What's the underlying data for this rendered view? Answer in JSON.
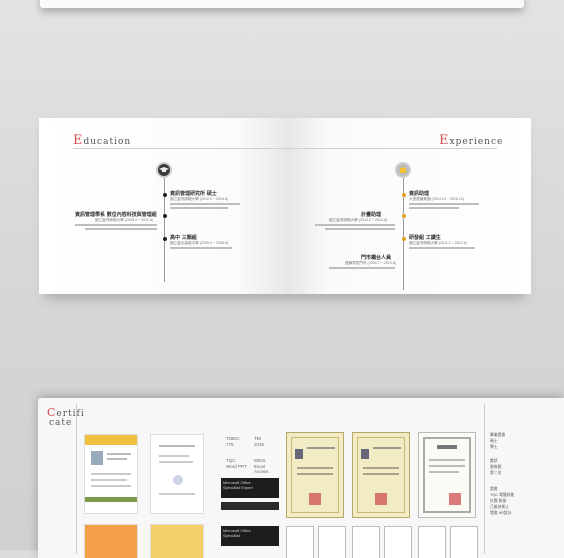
{
  "education": {
    "heading_cap": "E",
    "heading_rest": "ducation",
    "entries": [
      {
        "title": "資訊管理研究所 碩士",
        "sub": "國立臺灣師範大學 (2012.9 ~ 2014.6)"
      },
      {
        "title": "資訊管理學系 數位內容科技與管理組",
        "sub": "國立臺灣師範大學 (2008.9 ~ 2012.6)"
      },
      {
        "title": "高中 三類組",
        "sub": "國立臺北高級中學 (2005.9 ~ 2008.6)"
      }
    ]
  },
  "experience": {
    "heading_cap": "E",
    "heading_rest": "xperience",
    "entries": [
      {
        "title": "資訊助理",
        "sub": "大型連鎖集團 (2014.10 ~ 2016.12)"
      },
      {
        "title": "計畫助理",
        "sub": "國立臺灣師範大學 (2013.2 ~ 2014.6)"
      },
      {
        "title": "研發組 工讀生",
        "sub": "國立臺灣師範大學 (2011.2 ~ 2012.6)"
      },
      {
        "title": "門市櫃台人員",
        "sub": "連鎖零售門市 (2009.7 ~ 2010.8)"
      }
    ]
  },
  "certificate": {
    "heading_cap": "C",
    "heading_line1": "ertifi",
    "heading_line2": "cate",
    "tests": [
      {
        "name": "TOEIC",
        "score": "775"
      },
      {
        "name": "TBI",
        "score": "2016"
      },
      {
        "name": "TQC",
        "score": "Word PPT"
      },
      {
        "name": "MIOS",
        "score": "Excel Access"
      }
    ],
    "badges": [
      {
        "line1": "Microsoft Office",
        "line2": "Specialist Expert"
      },
      {
        "line1": "Microsoft Office",
        "line2": "Specialist"
      }
    ],
    "side_notes": [
      "畢業證書",
      "碩士",
      "學士",
      "獎狀",
      "書卷獎",
      "第二名",
      "證書",
      "TQC 電腦技能",
      "社團 幹部",
      "乙級技術士",
      "證書 AR設計"
    ]
  }
}
